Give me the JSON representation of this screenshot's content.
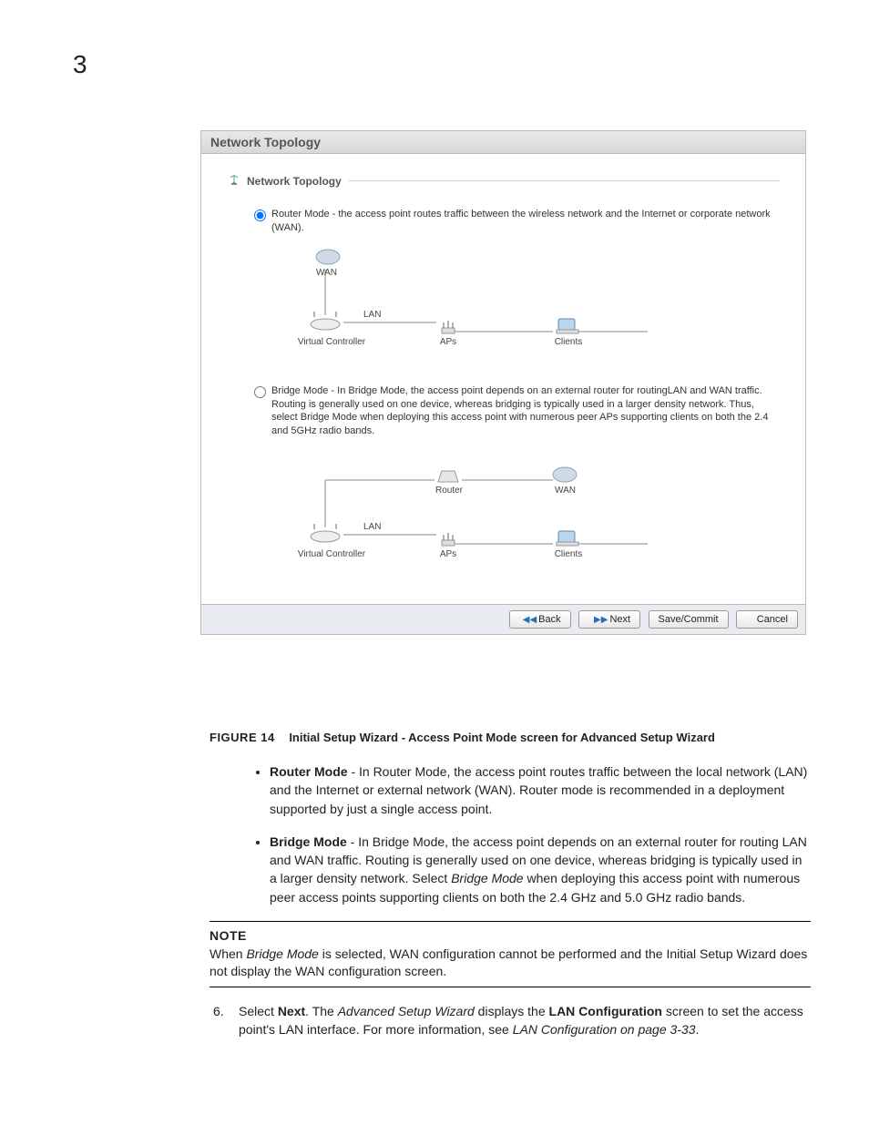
{
  "page_number": "3",
  "panel": {
    "title": "Network Topology",
    "group_label": "Network Topology",
    "router_mode_text": "Router Mode - the access point routes traffic between the wireless network and the Internet or corporate network (WAN).",
    "bridge_mode_text": "Bridge Mode - In Bridge Mode, the access point depends on an external router for routingLAN and WAN traffic. Routing is generally used on one device, whereas bridging is typically used in a larger density network. Thus, select Bridge Mode when deploying this access point with numerous peer APs supporting clients on both the 2.4 and 5GHz radio bands.",
    "diagram1": {
      "wan": "WAN",
      "lan": "LAN",
      "vc": "Virtual Controller",
      "aps": "APs",
      "clients": "Clients"
    },
    "diagram2": {
      "router": "Router",
      "wan": "WAN",
      "lan": "LAN",
      "vc": "Virtual Controller",
      "aps": "APs",
      "clients": "Clients"
    },
    "buttons": {
      "back": "Back",
      "next": "Next",
      "save": "Save/Commit",
      "cancel": "Cancel"
    }
  },
  "figure": {
    "label": "FIGURE 14",
    "title": "Initial Setup Wizard - Access Point Mode screen for Advanced Setup Wizard"
  },
  "bullets": {
    "router": {
      "lead": "Router Mode",
      "rest": " - In Router Mode, the access point routes traffic between the local network (LAN) and the Internet or external network (WAN). Router mode is recommended in a deployment supported by just a single access point."
    },
    "bridge": {
      "lead": "Bridge Mode",
      "rest_a": " - In Bridge Mode, the access point depends on an external router for routing LAN and WAN traffic. Routing is generally used on one device, whereas bridging is typically used in a larger density network. Select ",
      "italic": "Bridge Mode",
      "rest_b": " when deploying this access point with numerous peer access points supporting clients on both the 2.4 GHz and 5.0 GHz radio bands."
    }
  },
  "note": {
    "label": "NOTE",
    "a": "When ",
    "italic": "Bridge Mode",
    "b": " is selected, WAN configuration cannot be performed and the Initial Setup Wizard does not display the WAN configuration screen."
  },
  "step": {
    "num": "6.",
    "a": "Select ",
    "next": "Next",
    "b": ". The ",
    "wiz": "Advanced Setup Wizard",
    "c": " displays the ",
    "lan": "LAN Configuration",
    "d": " screen to set the access point's LAN interface. For more information, see ",
    "ref": "LAN Configuration on page 3-33",
    "e": "."
  }
}
